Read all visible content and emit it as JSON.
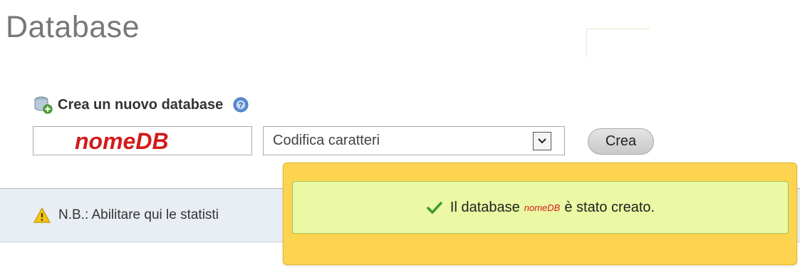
{
  "page": {
    "title": "Database"
  },
  "create_section": {
    "heading": "Crea un nuovo database",
    "name_value": "nomeDB",
    "charset_selected": "Codifica caratteri",
    "create_label": "Crea"
  },
  "notice": {
    "text": "N.B.: Abilitare qui le statisti"
  },
  "success": {
    "prefix": "Il database",
    "db_name": "nomeDB",
    "suffix": "è stato creato."
  },
  "colors": {
    "title": "#777777",
    "db_name_red": "#d21b1b",
    "popup_yellow": "#fdd44f",
    "success_green": "#ebf8a4",
    "notice_bar": "#e8eef3"
  },
  "icons": [
    "database-add-icon",
    "help-icon",
    "dropdown-arrow-icon",
    "warning-icon",
    "checkmark-icon"
  ]
}
